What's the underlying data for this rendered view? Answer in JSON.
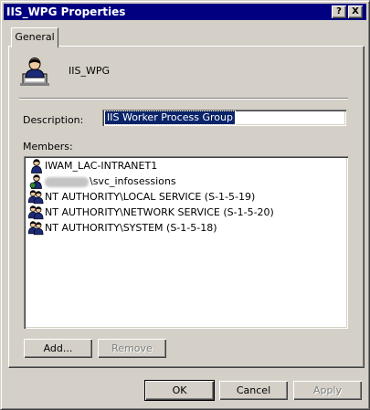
{
  "window": {
    "title": "IIS_WPG Properties"
  },
  "title_buttons": {
    "help": "?",
    "close": "X"
  },
  "tabs": [
    {
      "label": "General"
    }
  ],
  "group": {
    "name": "IIS_WPG",
    "icon": "user-group-icon"
  },
  "description": {
    "label": "Description:",
    "value": "IIS Worker Process Group"
  },
  "members": {
    "label": "Members:",
    "items": [
      {
        "text": "IWAM_LAC-INTRANET1",
        "icon": "user-icon"
      },
      {
        "text": "\\svc_infosessions",
        "icon": "user-icon"
      },
      {
        "text": "NT AUTHORITY\\LOCAL SERVICE (S-1-5-19)",
        "icon": "group-icon"
      },
      {
        "text": "NT AUTHORITY\\NETWORK SERVICE (S-1-5-20)",
        "icon": "group-icon"
      },
      {
        "text": "NT AUTHORITY\\SYSTEM (S-1-5-18)",
        "icon": "group-icon"
      }
    ]
  },
  "buttons": {
    "add": "Add...",
    "remove": "Remove",
    "ok": "OK",
    "cancel": "Cancel",
    "apply": "Apply"
  },
  "colors": {
    "titlebar": "#000080",
    "face": "#d4d0c8",
    "selection": "#0a246a"
  }
}
